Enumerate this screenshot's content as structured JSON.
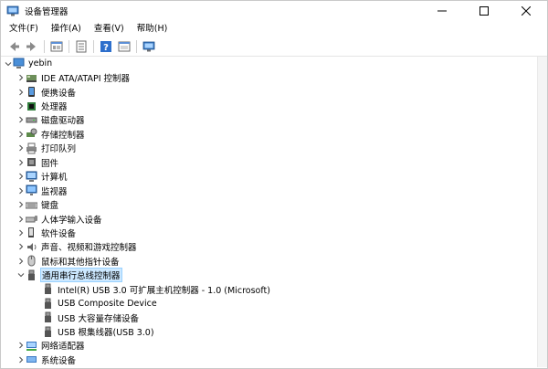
{
  "window": {
    "title": "设备管理器"
  },
  "menu": [
    {
      "label": "文件(F)"
    },
    {
      "label": "操作(A)"
    },
    {
      "label": "查看(V)"
    },
    {
      "label": "帮助(H)"
    }
  ],
  "toolbar": [
    "back-icon",
    "forward-icon",
    "properties-icon",
    "list-icon",
    "help-icon",
    "details-icon",
    "monitor-icon"
  ],
  "tree": {
    "root": "yebin",
    "categories": [
      {
        "label": "IDE ATA/ATAPI 控制器",
        "icon": "ide-controller-icon"
      },
      {
        "label": "便携设备",
        "icon": "portable-device-icon"
      },
      {
        "label": "处理器",
        "icon": "processor-icon"
      },
      {
        "label": "磁盘驱动器",
        "icon": "disk-drive-icon"
      },
      {
        "label": "存储控制器",
        "icon": "storage-controller-icon"
      },
      {
        "label": "打印队列",
        "icon": "printer-icon"
      },
      {
        "label": "固件",
        "icon": "firmware-icon"
      },
      {
        "label": "计算机",
        "icon": "computer-icon"
      },
      {
        "label": "监视器",
        "icon": "monitor-icon"
      },
      {
        "label": "键盘",
        "icon": "keyboard-icon"
      },
      {
        "label": "人体学输入设备",
        "icon": "hid-icon"
      },
      {
        "label": "软件设备",
        "icon": "software-device-icon"
      },
      {
        "label": "声音、视频和游戏控制器",
        "icon": "sound-icon"
      },
      {
        "label": "鼠标和其他指针设备",
        "icon": "mouse-icon"
      },
      {
        "label": "通用串行总线控制器",
        "icon": "usb-icon",
        "expanded": true,
        "selected": true,
        "children": [
          {
            "label": "Intel(R) USB 3.0 可扩展主机控制器 - 1.0 (Microsoft)"
          },
          {
            "label": "USB Composite Device"
          },
          {
            "label": "USB 大容量存储设备"
          },
          {
            "label": "USB 根集线器(USB 3.0)"
          }
        ]
      },
      {
        "label": "网络适配器",
        "icon": "network-adapter-icon"
      },
      {
        "label": "系统设备",
        "icon": "system-device-icon"
      }
    ]
  }
}
